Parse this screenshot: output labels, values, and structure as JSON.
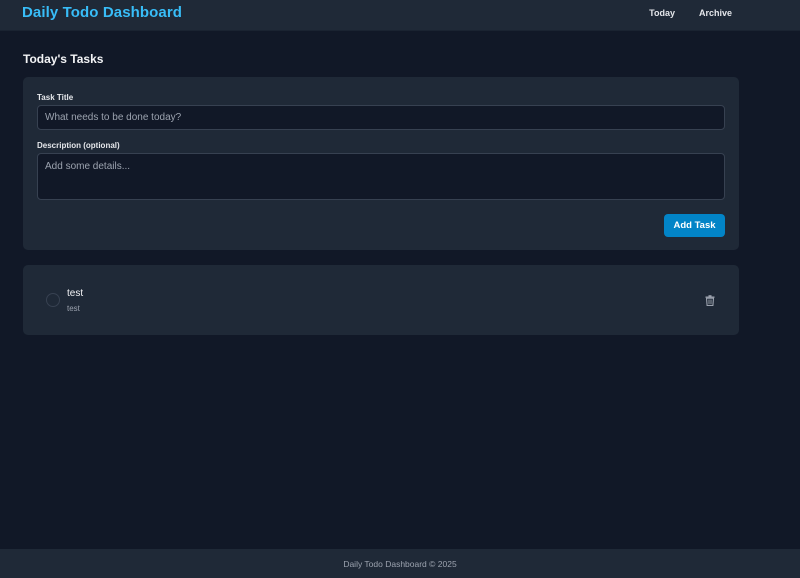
{
  "header": {
    "brand": "Daily Todo Dashboard",
    "nav": [
      {
        "label": "Today"
      },
      {
        "label": "Archive"
      }
    ]
  },
  "page": {
    "title": "Today's Tasks"
  },
  "form": {
    "title_label": "Task Title",
    "title_placeholder": "What needs to be done today?",
    "title_value": "",
    "description_label": "Description (optional)",
    "description_placeholder": "Add some details...",
    "description_value": "",
    "submit_label": "Add Task"
  },
  "tasks": [
    {
      "title": "test",
      "description": "test",
      "completed": false,
      "delete_icon": "trash-icon"
    }
  ],
  "footer": {
    "text": "Daily Todo Dashboard © 2025"
  },
  "colors": {
    "background": "#111827",
    "surface": "#1f2937",
    "accent": "#38bdf8",
    "button": "#0284c7"
  }
}
